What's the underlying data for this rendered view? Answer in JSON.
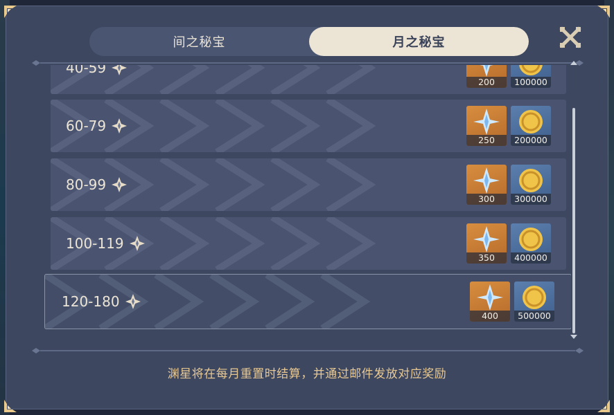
{
  "tabs": [
    {
      "label": "间之秘宝",
      "active": false
    },
    {
      "label": "月之秘宝",
      "active": true
    }
  ],
  "rows": [
    {
      "range": "40-59",
      "gem": "200",
      "coin": "100000",
      "selected": false
    },
    {
      "range": "60-79",
      "gem": "250",
      "coin": "200000",
      "selected": false
    },
    {
      "range": "80-99",
      "gem": "300",
      "coin": "300000",
      "selected": false
    },
    {
      "range": "100-119",
      "gem": "350",
      "coin": "400000",
      "selected": false
    },
    {
      "range": "120-180",
      "gem": "400",
      "coin": "500000",
      "selected": true
    }
  ],
  "footer": {
    "note": "渊星将在每月重置时结算，并通过邮件发放对应奖励"
  },
  "icons": {
    "close": "close-icon",
    "star": "abyss-star-icon",
    "gem": "primogem-icon",
    "coin": "mora-icon"
  },
  "colors": {
    "panel": "#3d4760",
    "row": "#4a5470",
    "tab_active": "#ece5d6",
    "note": "#e7c893",
    "gem_bg": "#d88e3f",
    "coin_bg": "#5b7fae"
  }
}
